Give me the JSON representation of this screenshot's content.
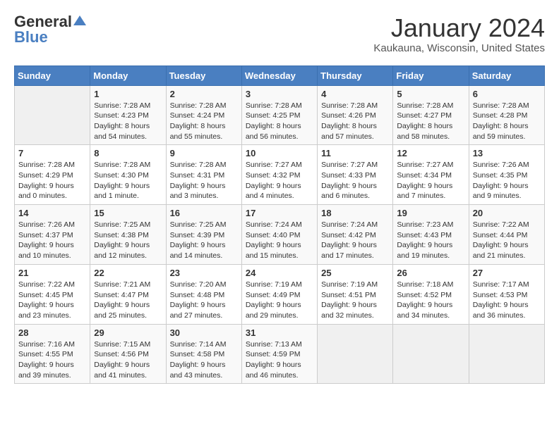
{
  "header": {
    "logo_general": "General",
    "logo_blue": "Blue",
    "month_title": "January 2024",
    "location": "Kaukauna, Wisconsin, United States"
  },
  "days_of_week": [
    "Sunday",
    "Monday",
    "Tuesday",
    "Wednesday",
    "Thursday",
    "Friday",
    "Saturday"
  ],
  "weeks": [
    [
      {
        "num": "",
        "info": ""
      },
      {
        "num": "1",
        "info": "Sunrise: 7:28 AM\nSunset: 4:23 PM\nDaylight: 8 hours\nand 54 minutes."
      },
      {
        "num": "2",
        "info": "Sunrise: 7:28 AM\nSunset: 4:24 PM\nDaylight: 8 hours\nand 55 minutes."
      },
      {
        "num": "3",
        "info": "Sunrise: 7:28 AM\nSunset: 4:25 PM\nDaylight: 8 hours\nand 56 minutes."
      },
      {
        "num": "4",
        "info": "Sunrise: 7:28 AM\nSunset: 4:26 PM\nDaylight: 8 hours\nand 57 minutes."
      },
      {
        "num": "5",
        "info": "Sunrise: 7:28 AM\nSunset: 4:27 PM\nDaylight: 8 hours\nand 58 minutes."
      },
      {
        "num": "6",
        "info": "Sunrise: 7:28 AM\nSunset: 4:28 PM\nDaylight: 8 hours\nand 59 minutes."
      }
    ],
    [
      {
        "num": "7",
        "info": "Sunrise: 7:28 AM\nSunset: 4:29 PM\nDaylight: 9 hours\nand 0 minutes."
      },
      {
        "num": "8",
        "info": "Sunrise: 7:28 AM\nSunset: 4:30 PM\nDaylight: 9 hours\nand 1 minute."
      },
      {
        "num": "9",
        "info": "Sunrise: 7:28 AM\nSunset: 4:31 PM\nDaylight: 9 hours\nand 3 minutes."
      },
      {
        "num": "10",
        "info": "Sunrise: 7:27 AM\nSunset: 4:32 PM\nDaylight: 9 hours\nand 4 minutes."
      },
      {
        "num": "11",
        "info": "Sunrise: 7:27 AM\nSunset: 4:33 PM\nDaylight: 9 hours\nand 6 minutes."
      },
      {
        "num": "12",
        "info": "Sunrise: 7:27 AM\nSunset: 4:34 PM\nDaylight: 9 hours\nand 7 minutes."
      },
      {
        "num": "13",
        "info": "Sunrise: 7:26 AM\nSunset: 4:35 PM\nDaylight: 9 hours\nand 9 minutes."
      }
    ],
    [
      {
        "num": "14",
        "info": "Sunrise: 7:26 AM\nSunset: 4:37 PM\nDaylight: 9 hours\nand 10 minutes."
      },
      {
        "num": "15",
        "info": "Sunrise: 7:25 AM\nSunset: 4:38 PM\nDaylight: 9 hours\nand 12 minutes."
      },
      {
        "num": "16",
        "info": "Sunrise: 7:25 AM\nSunset: 4:39 PM\nDaylight: 9 hours\nand 14 minutes."
      },
      {
        "num": "17",
        "info": "Sunrise: 7:24 AM\nSunset: 4:40 PM\nDaylight: 9 hours\nand 15 minutes."
      },
      {
        "num": "18",
        "info": "Sunrise: 7:24 AM\nSunset: 4:42 PM\nDaylight: 9 hours\nand 17 minutes."
      },
      {
        "num": "19",
        "info": "Sunrise: 7:23 AM\nSunset: 4:43 PM\nDaylight: 9 hours\nand 19 minutes."
      },
      {
        "num": "20",
        "info": "Sunrise: 7:22 AM\nSunset: 4:44 PM\nDaylight: 9 hours\nand 21 minutes."
      }
    ],
    [
      {
        "num": "21",
        "info": "Sunrise: 7:22 AM\nSunset: 4:45 PM\nDaylight: 9 hours\nand 23 minutes."
      },
      {
        "num": "22",
        "info": "Sunrise: 7:21 AM\nSunset: 4:47 PM\nDaylight: 9 hours\nand 25 minutes."
      },
      {
        "num": "23",
        "info": "Sunrise: 7:20 AM\nSunset: 4:48 PM\nDaylight: 9 hours\nand 27 minutes."
      },
      {
        "num": "24",
        "info": "Sunrise: 7:19 AM\nSunset: 4:49 PM\nDaylight: 9 hours\nand 29 minutes."
      },
      {
        "num": "25",
        "info": "Sunrise: 7:19 AM\nSunset: 4:51 PM\nDaylight: 9 hours\nand 32 minutes."
      },
      {
        "num": "26",
        "info": "Sunrise: 7:18 AM\nSunset: 4:52 PM\nDaylight: 9 hours\nand 34 minutes."
      },
      {
        "num": "27",
        "info": "Sunrise: 7:17 AM\nSunset: 4:53 PM\nDaylight: 9 hours\nand 36 minutes."
      }
    ],
    [
      {
        "num": "28",
        "info": "Sunrise: 7:16 AM\nSunset: 4:55 PM\nDaylight: 9 hours\nand 39 minutes."
      },
      {
        "num": "29",
        "info": "Sunrise: 7:15 AM\nSunset: 4:56 PM\nDaylight: 9 hours\nand 41 minutes."
      },
      {
        "num": "30",
        "info": "Sunrise: 7:14 AM\nSunset: 4:58 PM\nDaylight: 9 hours\nand 43 minutes."
      },
      {
        "num": "31",
        "info": "Sunrise: 7:13 AM\nSunset: 4:59 PM\nDaylight: 9 hours\nand 46 minutes."
      },
      {
        "num": "",
        "info": ""
      },
      {
        "num": "",
        "info": ""
      },
      {
        "num": "",
        "info": ""
      }
    ]
  ]
}
